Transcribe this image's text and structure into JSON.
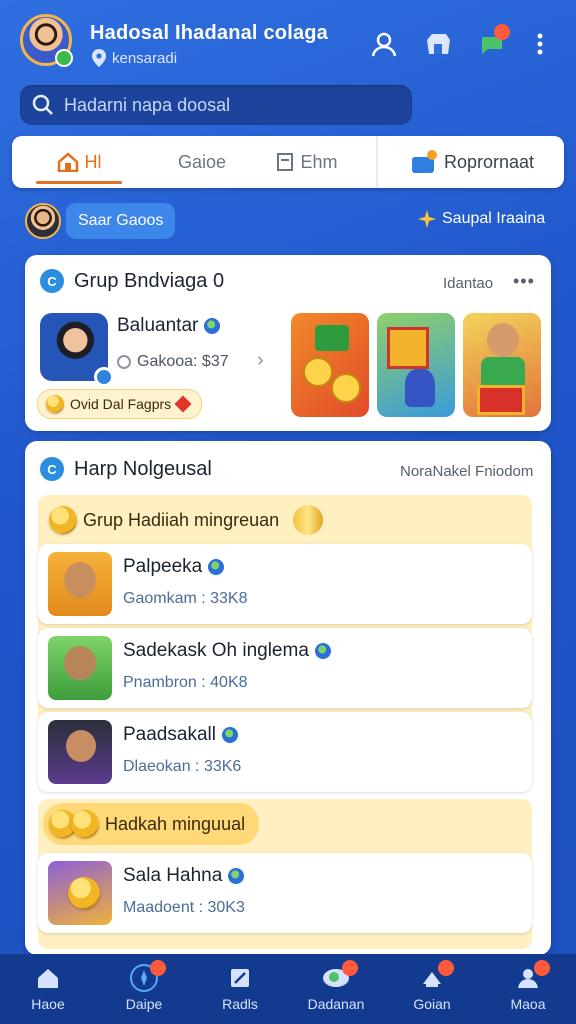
{
  "header": {
    "title": "Hadosal Ihadanal colaga",
    "subtitle": "kensaradi"
  },
  "search": {
    "placeholder": "Hadarni napa doosal"
  },
  "tabs": [
    {
      "label": "Hl",
      "active": true
    },
    {
      "label": "Gaioe",
      "active": false
    },
    {
      "label": "Ehm",
      "active": false
    },
    {
      "label": "Roprornaat",
      "active": false
    }
  ],
  "mini_row": {
    "pill": "Saar Gaoos",
    "right": "Saupal Iraaina"
  },
  "card1": {
    "title": "Grup Bndviaga 0",
    "meta": "Idantao",
    "featured": {
      "name": "Baluantar",
      "sub": "Gakooa: $37",
      "pill": "Ovid Dal Fagprs"
    }
  },
  "card2": {
    "title": "Harp Nolgeusal",
    "meta": "NoraNakel Fniodom",
    "section1": "Grup Hadiiah mingreuan",
    "section2": "Hadkah minguual",
    "rows": [
      {
        "name": "Palpeeka",
        "meta": "Gaomkam : 33K8"
      },
      {
        "name": "Sadekask Oh inglema",
        "meta": "Pnambron : 40K8"
      },
      {
        "name": "Paadsakall",
        "meta": "Dlaeokan : 33K6"
      },
      {
        "name": "Sala Hahna",
        "meta": "Maadoent : 30K3"
      }
    ]
  },
  "bottom_nav": [
    {
      "label": "Haoe",
      "badge": false
    },
    {
      "label": "Daipe",
      "badge": true,
      "active": true
    },
    {
      "label": "Radls",
      "badge": false
    },
    {
      "label": "Dadanan",
      "badge": true
    },
    {
      "label": "Goian",
      "badge": true
    },
    {
      "label": "Maoa",
      "badge": true
    }
  ],
  "colors": {
    "accent": "#e0701c",
    "brand": "#1f55c9",
    "badge": "#ff5a3c"
  }
}
